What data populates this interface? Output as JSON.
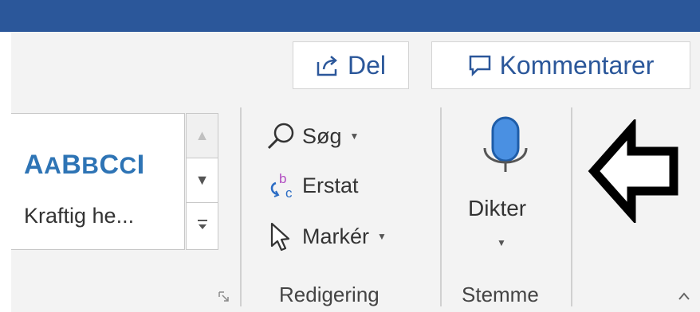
{
  "titlebar": {
    "accent": "#2b579a"
  },
  "top_buttons": {
    "share_label": "Del",
    "comments_label": "Kommentarer"
  },
  "styles_gallery": {
    "preview": [
      "A",
      "A",
      "B",
      "B",
      "C",
      "C",
      "I"
    ],
    "style_name": "Kraftig he...",
    "preview_color": "#2e74b5"
  },
  "editing_group": {
    "find_label": "Søg",
    "replace_label": "Erstat",
    "select_label": "Markér",
    "group_label": "Redigering"
  },
  "voice_group": {
    "dictate_label": "Dikter",
    "group_label": "Stemme"
  },
  "annotation": {
    "arrow_icon": "left-arrow-outline"
  }
}
